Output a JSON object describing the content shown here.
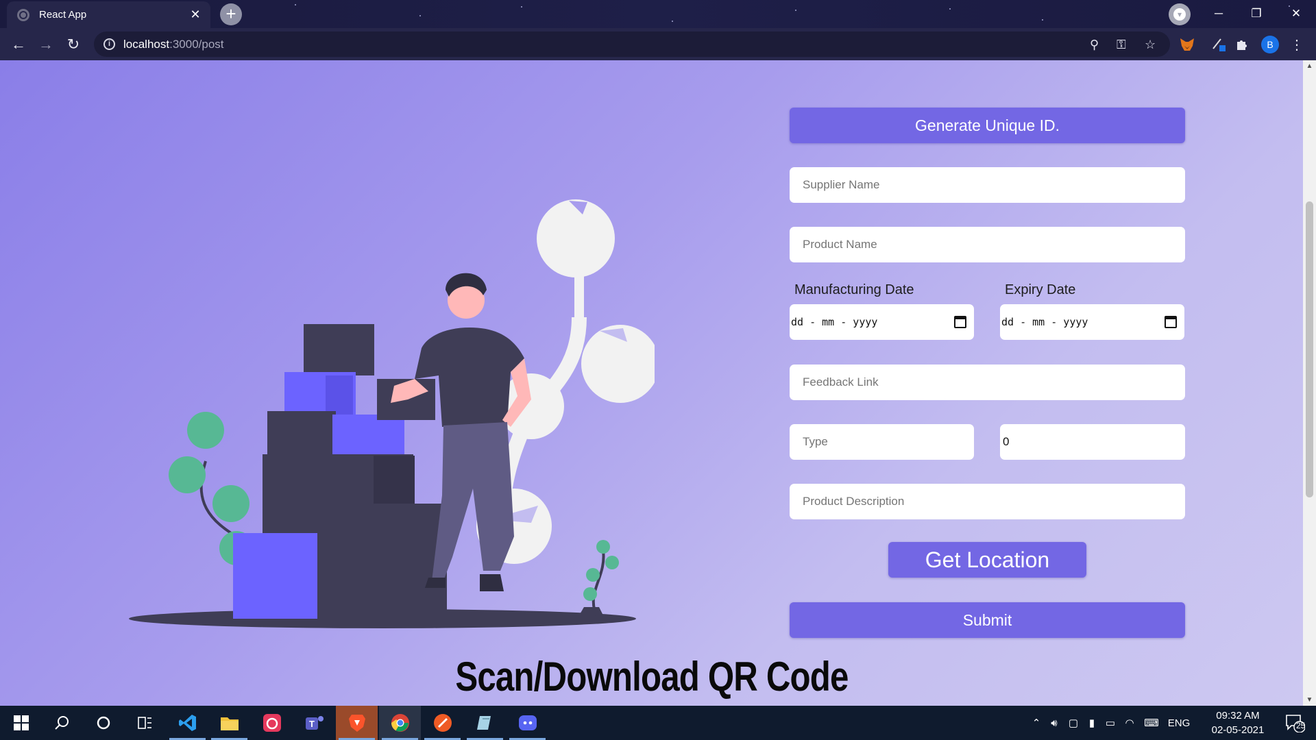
{
  "browser": {
    "tab_title": "React App",
    "tab_close": "✕",
    "new_tab": "+",
    "url_host": "localhost",
    "url_path": ":3000/post",
    "avatar_letter": "B",
    "window_controls": {
      "minimize": "─",
      "restore": "❐",
      "close": "✕"
    }
  },
  "form": {
    "generate_button": "Generate Unique ID.",
    "supplier_placeholder": "Supplier Name",
    "product_placeholder": "Product Name",
    "manufacturing_label": "Manufacturing Date",
    "expiry_label": "Expiry Date",
    "date_placeholder": "dd - mm - yyyy",
    "feedback_placeholder": "Feedback Link",
    "type_placeholder": "Type",
    "number_value": "0",
    "description_placeholder": "Product Description",
    "location_button": "Get Location",
    "submit_button": "Submit"
  },
  "qr_heading": "Scan/Download QR Code",
  "taskbar": {
    "language": "ENG",
    "time": "09:32 AM",
    "date": "02-05-2021",
    "notification_count": "25"
  },
  "colors": {
    "accent": "#7367e4",
    "box_dark": "#3f3d56",
    "box_blue": "#6c63ff",
    "plant_green": "#57b894"
  }
}
